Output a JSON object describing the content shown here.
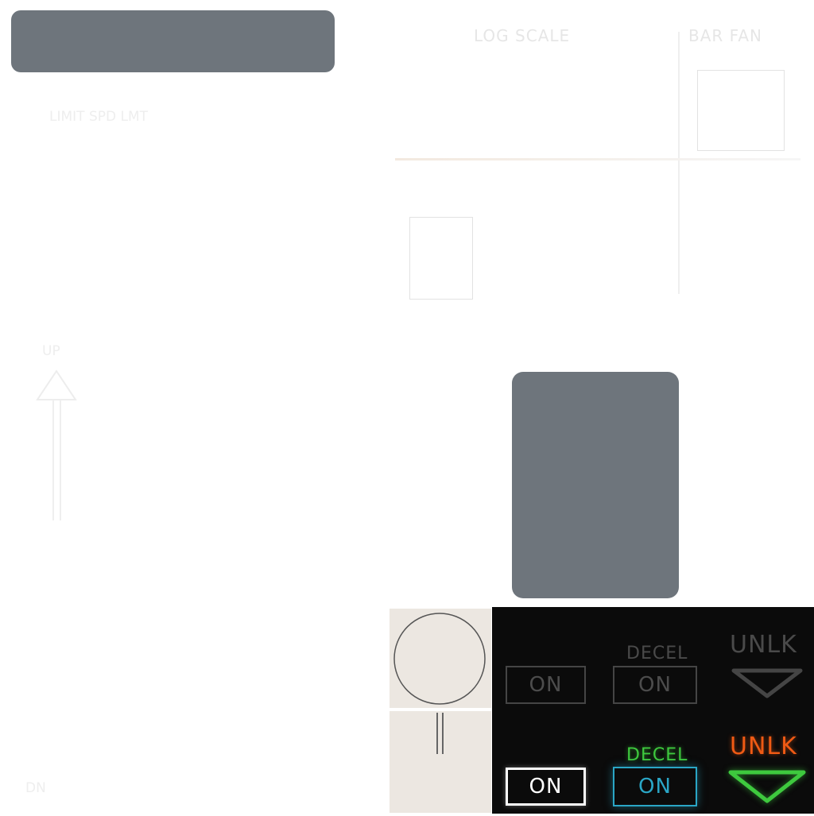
{
  "ghost_text": {
    "log_scale": "LOG SCALE",
    "bar_fan": "BAR FAN",
    "limit_speed": "LIMIT  SPD  LMT",
    "up": "UP",
    "down": "DN"
  },
  "annunciators": {
    "off": {
      "on_left": "ON",
      "decel_label": "DECEL",
      "decel_on": "ON",
      "unlock": "UNLK"
    },
    "lit": {
      "on_left": "ON",
      "decel_label": "DECEL",
      "decel_on": "ON",
      "unlock": "UNLK"
    }
  },
  "colors": {
    "gray_panel": "#6e757c",
    "beige_tile": "#ece7e1",
    "panel_black": "#0b0b0b",
    "dim": "#4a4a4a",
    "lit_white": "#ffffff",
    "lit_cyan": "#2aa6c6",
    "lit_green": "#3ec93e",
    "lit_orange": "#f05a14"
  }
}
